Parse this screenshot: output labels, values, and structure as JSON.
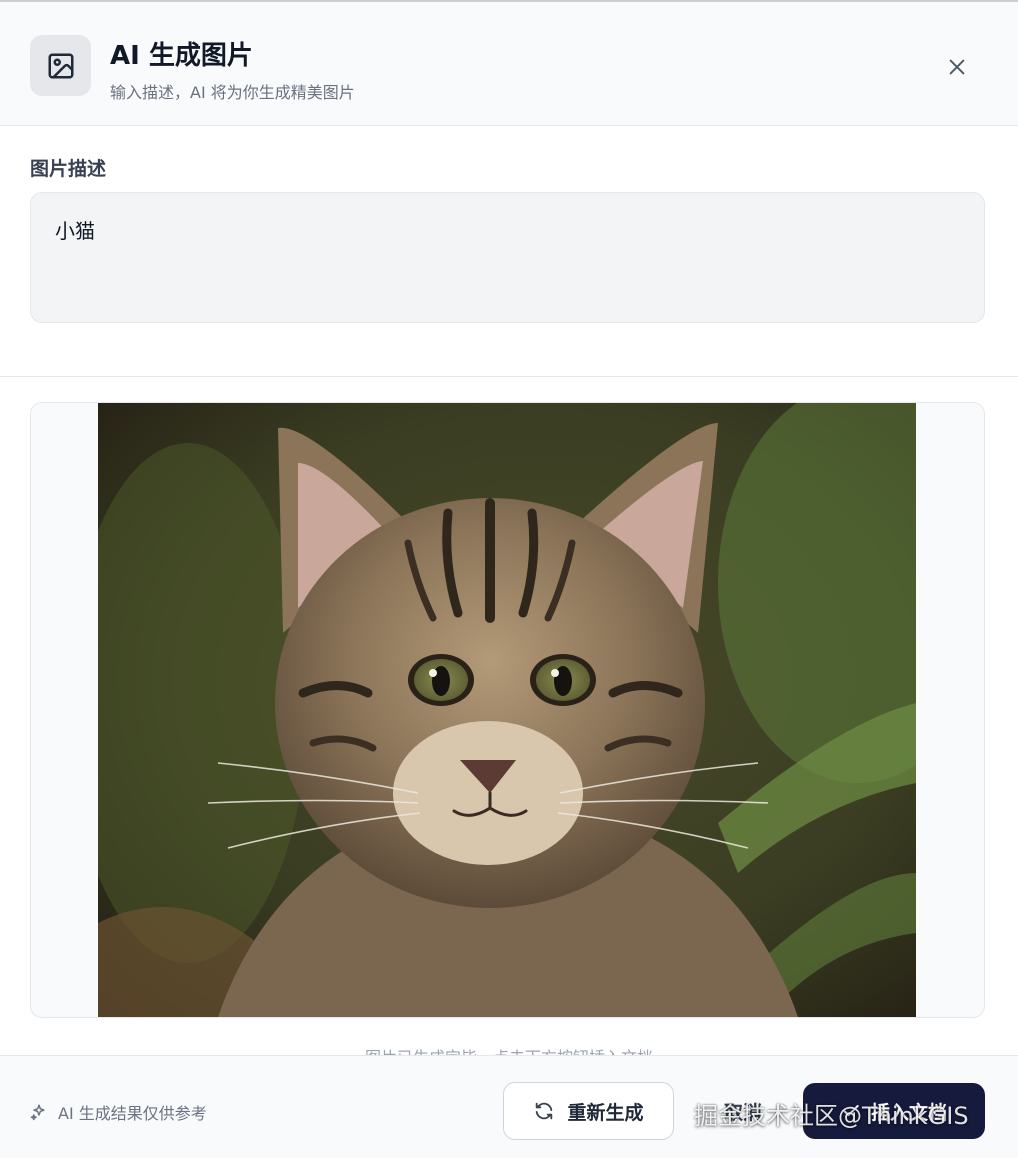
{
  "header": {
    "icon": "image-icon",
    "title": "AI 生成图片",
    "subtitle": "输入描述，AI 将为你生成精美图片",
    "close_icon": "close-icon"
  },
  "description": {
    "label": "图片描述",
    "value": "小猫"
  },
  "preview": {
    "subject": "kitten",
    "hint": "图片已生成完毕，点击下方按钮插入文档"
  },
  "footer": {
    "note_icon": "sparkle-icon",
    "note": "AI 生成结果仅供参考",
    "regenerate_icon": "refresh-icon",
    "regenerate_label": "重新生成",
    "cancel_label": "取消",
    "insert_icon": "check-icon",
    "insert_label": "插入文档"
  },
  "watermark": "掘金技术社区@ThinkGIS",
  "colors": {
    "primary_button": "#161b3d",
    "header_bg": "#f8fafc",
    "input_bg": "#f3f4f6"
  }
}
